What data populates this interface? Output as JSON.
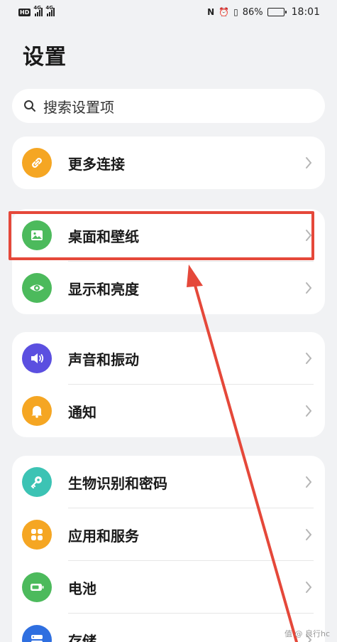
{
  "status_bar": {
    "network_badge": "HD",
    "signal_1_tag": "4G",
    "signal_2_tag": "4G",
    "nfc_symbol": "N",
    "alarm_symbol": "⏰",
    "vibrate_symbol": "▯",
    "battery_percent": "86%",
    "battery_level": 0.86,
    "time": "18:01"
  },
  "page": {
    "title": "设置"
  },
  "search": {
    "placeholder": "搜索设置项"
  },
  "groups": [
    {
      "items": [
        {
          "label": "更多连接",
          "icon": "link-icon",
          "color": "#f5a623"
        }
      ]
    },
    {
      "items": [
        {
          "label": "桌面和壁纸",
          "icon": "wallpaper-icon",
          "color": "#4cba5c"
        },
        {
          "label": "显示和亮度",
          "icon": "eye-icon",
          "color": "#4cba5c"
        }
      ]
    },
    {
      "items": [
        {
          "label": "声音和振动",
          "icon": "speaker-icon",
          "color": "#5b4fe0"
        },
        {
          "label": "通知",
          "icon": "bell-icon",
          "color": "#f5a623"
        }
      ]
    },
    {
      "items": [
        {
          "label": "生物识别和密码",
          "icon": "key-icon",
          "color": "#3cc3b4"
        },
        {
          "label": "应用和服务",
          "icon": "apps-icon",
          "color": "#f5a623"
        },
        {
          "label": "电池",
          "icon": "battery-icon",
          "color": "#4cba5c"
        },
        {
          "label": "存储",
          "icon": "storage-icon",
          "color": "#2f6fe0"
        }
      ]
    }
  ],
  "annotation": {
    "highlight_color": "#e5483a"
  },
  "watermark": "值 @ 良行hc"
}
